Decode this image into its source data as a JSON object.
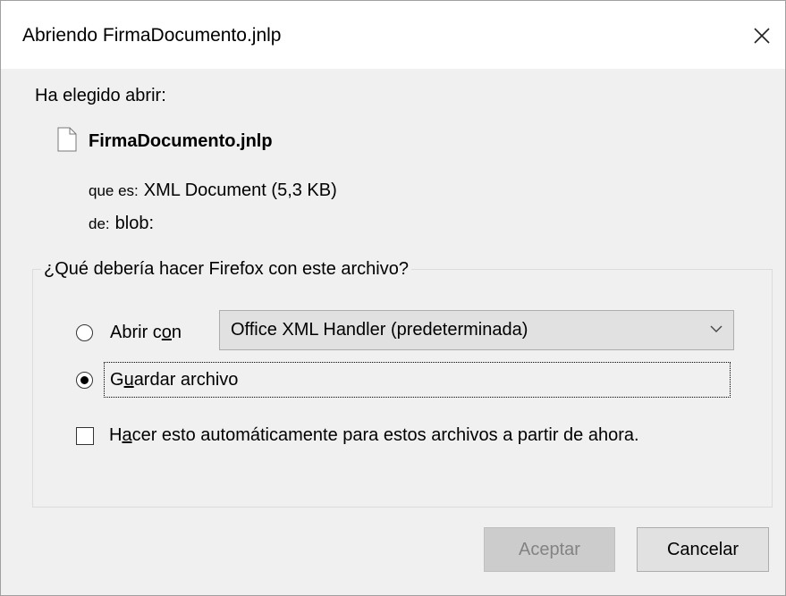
{
  "dialog": {
    "title": "Abriendo FirmaDocumento.jnlp",
    "intro": "Ha elegido abrir:",
    "file": {
      "name": "FirmaDocumento.jnlp",
      "type_label": "que es:",
      "type_value": "XML Document (5,3 KB)",
      "from_label": "de:",
      "from_value": "blob:"
    },
    "action_group": {
      "legend": "¿Qué debería hacer Firefox con este archivo?",
      "open_with": {
        "label_pre": "Abrir c",
        "label_mnemonic": "o",
        "label_post": "n",
        "selected": false
      },
      "handler_select": {
        "value": "Office XML Handler (predeterminada)"
      },
      "save_file": {
        "label_pre": "G",
        "label_mnemonic": "u",
        "label_post": "ardar archivo",
        "selected": true
      },
      "auto": {
        "label_pre": "H",
        "label_mnemonic": "a",
        "label_post": "cer esto automáticamente para estos archivos a partir de ahora.",
        "checked": false
      }
    },
    "buttons": {
      "ok": "Aceptar",
      "cancel": "Cancelar"
    },
    "colors": {
      "dialog_bg": "#f0f0f0",
      "titlebar_bg": "#ffffff",
      "disabled_text": "#838383"
    }
  }
}
